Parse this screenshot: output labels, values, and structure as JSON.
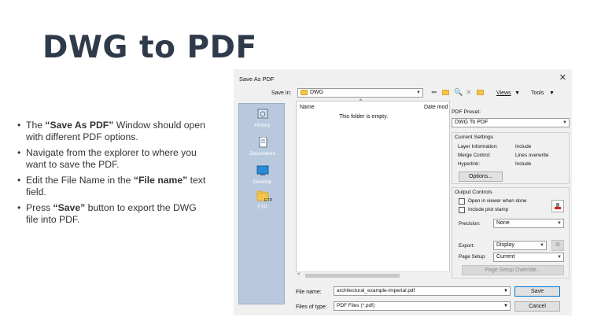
{
  "slide": {
    "title": "DWG to PDF",
    "bullets": [
      {
        "pre": "The ",
        "bold": "“Save As PDF”",
        "post": " Window should open with different PDF options."
      },
      {
        "pre": "Navigate from the explorer to where you want to save the PDF.",
        "bold": "",
        "post": ""
      },
      {
        "pre": "Edit the File Name in the ",
        "bold": "“File name”",
        "post": " text field."
      },
      {
        "pre": "Press ",
        "bold": "“Save”",
        "post": " button to export the DWG file into PDF."
      }
    ]
  },
  "dialog": {
    "title": "Save As PDF",
    "close": "✕",
    "save_in_label": "Save in:",
    "save_in_value": "DWG",
    "views_label": "Views",
    "tools_label": "Tools",
    "places": [
      "History",
      "Documents",
      "Desktop",
      "FTP"
    ],
    "ftp_badge": "FTP",
    "columns": {
      "name": "Name",
      "date": "Date mod"
    },
    "empty_message": "This folder is empty.",
    "file_name_label": "File name:",
    "file_name_value": "architectural_example-imperial.pdf",
    "file_type_label": "Files of type:",
    "file_type_value": "PDF Files (*.pdf)",
    "save_button": "Save",
    "cancel_button": "Cancel",
    "pdf_preset_label": "PDF Preset:",
    "pdf_preset_value": "DWG To PDF",
    "current_settings": {
      "title": "Current Settings",
      "rows": [
        {
          "label": "Layer Information:",
          "value": "Include"
        },
        {
          "label": "Merge Control:",
          "value": "Lines overwrite"
        },
        {
          "label": "Hyperlink:",
          "value": "Include"
        }
      ],
      "options_button": "Options..."
    },
    "output_controls": {
      "title": "Output Controls",
      "open_viewer": "Open in viewer when done",
      "include_stamp": "Include plot stamp",
      "precision_label": "Precision:",
      "precision_value": "None",
      "export_label": "Export:",
      "export_value": "Display",
      "page_setup_label": "Page Setup:",
      "page_setup_value": "Current",
      "override_button": "Page Setup Override..."
    }
  },
  "colors": {
    "title": "#2f3b4a",
    "places_bg": "#b9c9dd",
    "folder": "#f3c64a",
    "accent": "#0078d7"
  }
}
